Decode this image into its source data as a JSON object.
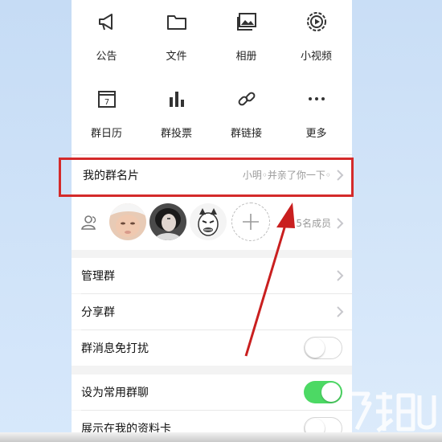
{
  "grid": {
    "tiles": [
      {
        "label": "公告",
        "icon": "megaphone-icon"
      },
      {
        "label": "文件",
        "icon": "folder-icon"
      },
      {
        "label": "相册",
        "icon": "photo-album-icon"
      },
      {
        "label": "小视频",
        "icon": "video-play-icon"
      },
      {
        "label": "群日历",
        "icon": "calendar-icon"
      },
      {
        "label": "群投票",
        "icon": "bar-chart-icon"
      },
      {
        "label": "群链接",
        "icon": "link-icon"
      },
      {
        "label": "更多",
        "icon": "more-dots-icon"
      }
    ],
    "calendar_day": "7"
  },
  "group_card": {
    "label": "我的群名片",
    "value": "小明◦并亲了你一下◦"
  },
  "members": {
    "count_label": "5名成员",
    "add_symbol": "+"
  },
  "settings": {
    "manage_group": "管理群",
    "share_group": "分享群",
    "mute_messages": {
      "label": "群消息免打扰",
      "on": false
    },
    "set_frequent": {
      "label": "设为常用群聊",
      "on": true
    },
    "show_on_profile": {
      "label": "展示在我的资料卡",
      "on": false
    }
  },
  "colors": {
    "toggle_on": "#4cd964",
    "highlight": "#d42a2a",
    "background": "#cfe4fb"
  }
}
